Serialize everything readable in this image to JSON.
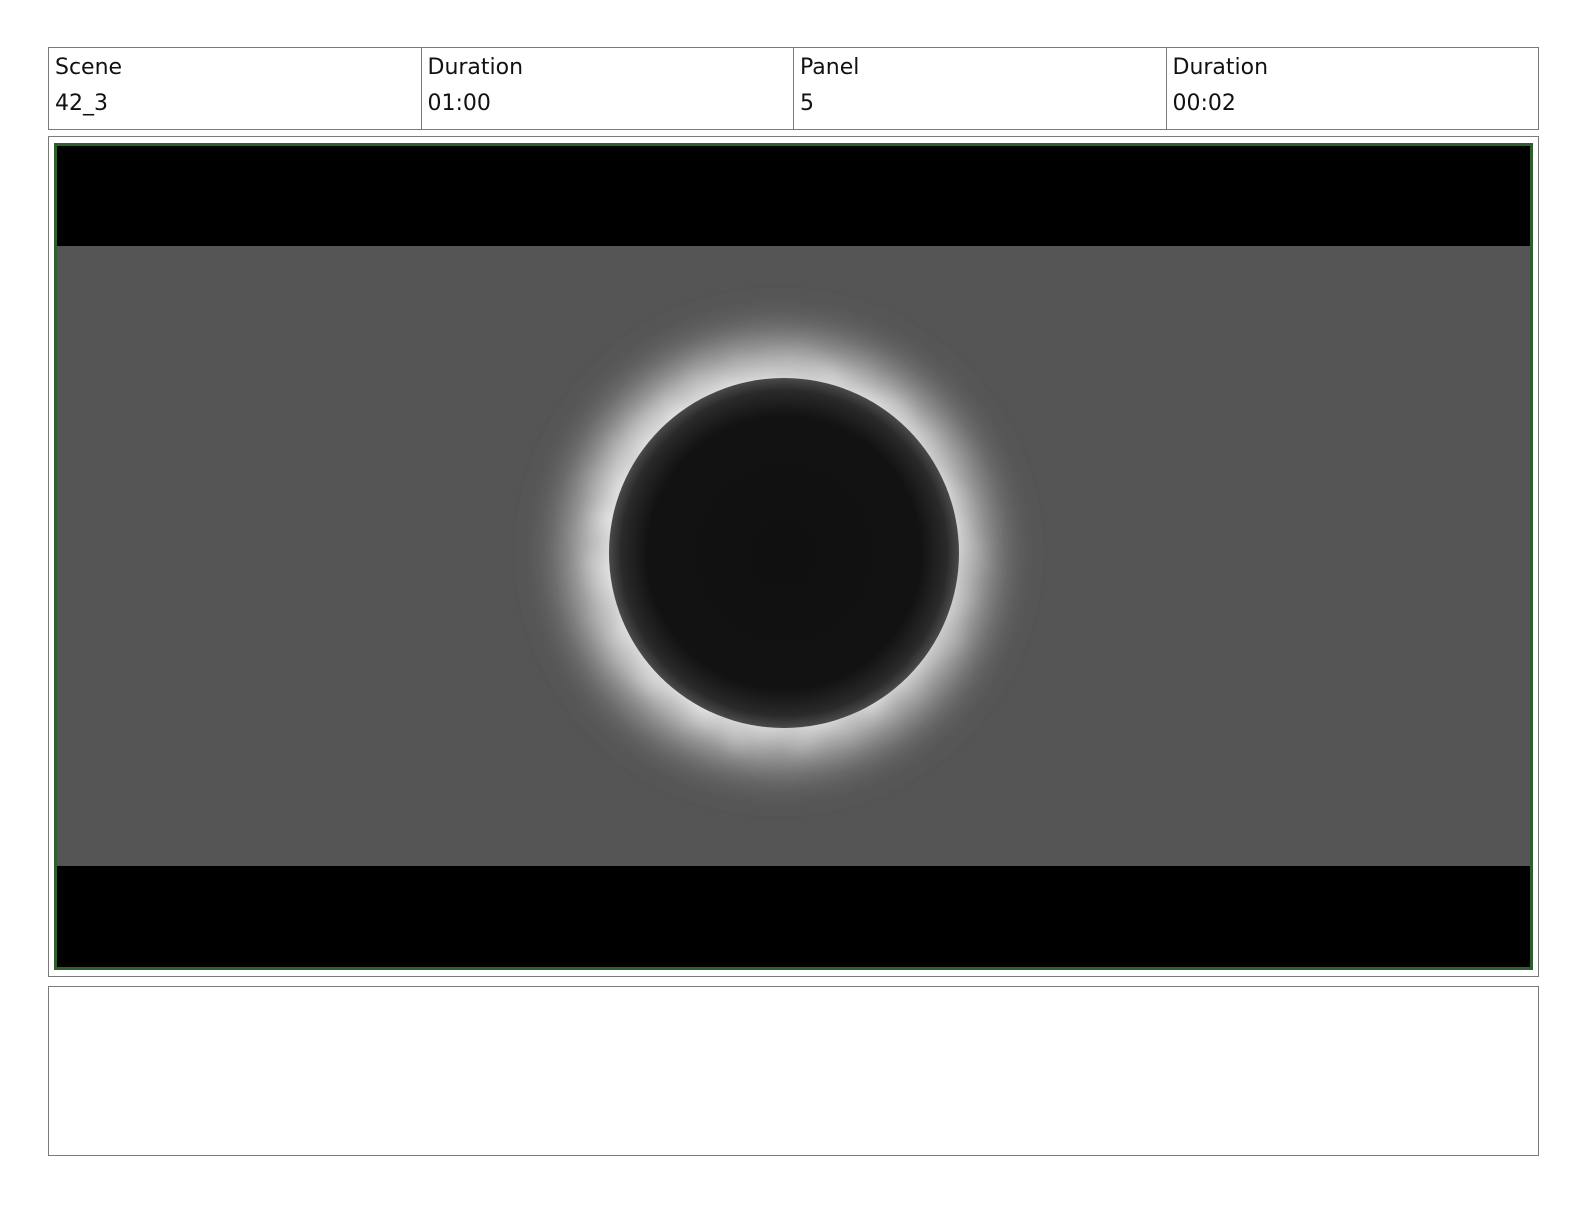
{
  "header": {
    "scene_label": "Scene",
    "scene_value": "42_3",
    "scene_duration_label": "Duration",
    "scene_duration_value": "01:00",
    "panel_label": "Panel",
    "panel_value": "5",
    "panel_duration_label": "Duration",
    "panel_duration_value": "00:02"
  },
  "panel": {
    "subject": "solar-eclipse",
    "colors": {
      "frame_border": "#2f5e2f",
      "letterbox": "#000000",
      "sky": "#555555",
      "moon": "#101010",
      "corona": "#ffffff"
    }
  },
  "notes": {
    "text": ""
  }
}
